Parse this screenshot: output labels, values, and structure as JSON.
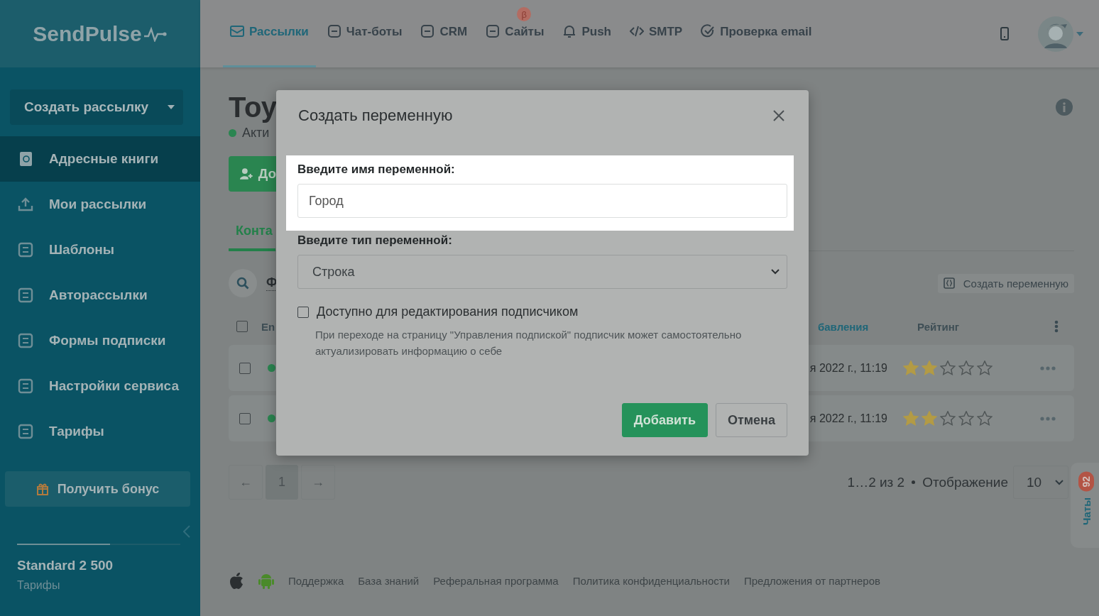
{
  "sidebar": {
    "logo": "SendPulse",
    "create_button": "Создать рассылку",
    "items": [
      {
        "label": "Адресные книги",
        "selected": true
      },
      {
        "label": "Мои рассылки",
        "selected": false
      },
      {
        "label": "Шаблоны",
        "selected": false
      },
      {
        "label": "Авторассылки",
        "selected": false
      },
      {
        "label": "Формы подписки",
        "selected": false
      },
      {
        "label": "Настройки сервиса",
        "selected": false
      },
      {
        "label": "Тарифы",
        "selected": false
      }
    ],
    "bonus_button": "Получить бонус",
    "plan": {
      "name": "Standard 2 500",
      "link": "Тарифы"
    }
  },
  "top_nav": {
    "items": [
      {
        "label": "Рассылки",
        "selected": true
      },
      {
        "label": "Чат-боты",
        "selected": false
      },
      {
        "label": "CRM",
        "selected": false
      },
      {
        "label": "Сайты",
        "selected": false,
        "badge": "β"
      },
      {
        "label": "Push",
        "selected": false
      },
      {
        "label": "SMTP",
        "selected": false
      },
      {
        "label": "Проверка email",
        "selected": false
      }
    ]
  },
  "page": {
    "title": "Тоу",
    "status": "Акти",
    "add_button": "До",
    "tab": "Конта",
    "filter": "Ф",
    "create_variable_button": "Создать переменную",
    "table": {
      "header_checked": false,
      "columns": [
        "En",
        "бавления",
        "Рейтинг"
      ],
      "rows": [
        {
          "checked": false,
          "date": "я 2022 г., 11:19",
          "stars": 2
        },
        {
          "checked": false,
          "date": "я 2022 г., 11:19",
          "stars": 2
        }
      ]
    }
  },
  "pagination": {
    "prev": "←",
    "pages": [
      {
        "label": "1",
        "selected": true
      }
    ],
    "next": "→",
    "summary": "1…2 из 2",
    "per_page_label": "Отображение",
    "per_page": "10"
  },
  "chat_tab": {
    "label": "Чаты",
    "count": "92"
  },
  "footer": {
    "links": [
      "Поддержка",
      "База знаний",
      "Реферальная программа",
      "Политика конфиденциальности",
      "Предложения от партнеров"
    ]
  },
  "dialog": {
    "title": "Создать переменную",
    "name_label": "Введите имя переменной:",
    "name_value": "Город",
    "name_highlighted": true,
    "type_label": "Введите тип переменной:",
    "type_value": "Строка",
    "editable": {
      "label": "Доступно для редактирования подписчиком",
      "checked": false
    },
    "hint": "При переходе на страницу \"Управления подпиской\" подписчик может самостоятельно актуализировать информацию о себе",
    "buttons": [
      {
        "label": "Добавить",
        "kind": "primary"
      },
      {
        "label": "Отмена",
        "kind": "secondary"
      }
    ]
  }
}
